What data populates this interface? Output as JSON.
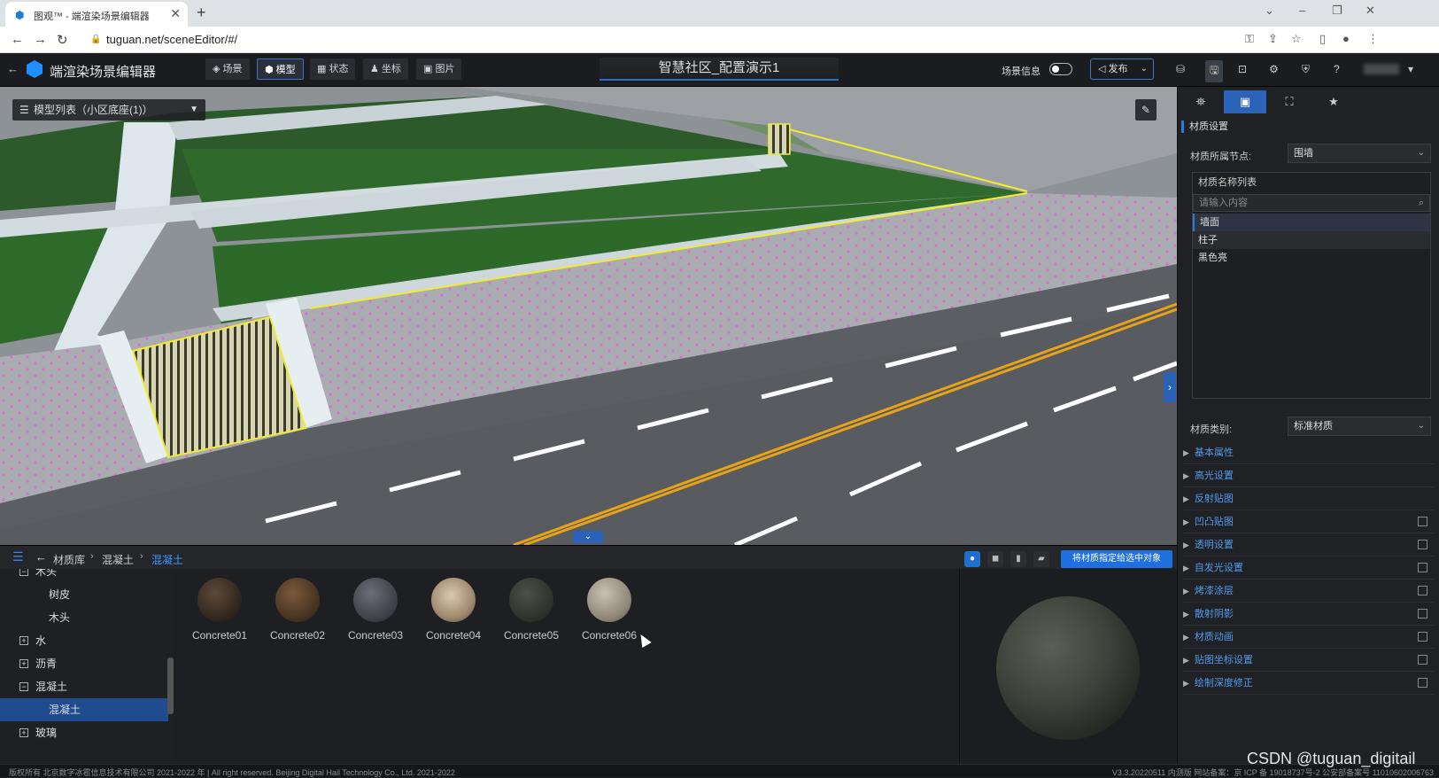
{
  "browser": {
    "tab_title": "图观™ - 端渲染场景编辑器",
    "tab_close": "✕",
    "new_tab": "+",
    "url": "tuguan.net/sceneEditor/#/"
  },
  "app": {
    "title": "端渲染场景编辑器",
    "nav_tabs": [
      {
        "icon": "layers-icon",
        "label": "场景"
      },
      {
        "icon": "cube-icon",
        "label": "模型"
      },
      {
        "icon": "grid-icon",
        "label": "状态"
      },
      {
        "icon": "person-icon",
        "label": "坐标"
      },
      {
        "icon": "image-icon",
        "label": "图片"
      }
    ],
    "active_tab": "模型",
    "scene_name": "智慧社区_配置演示1",
    "scene_info_label": "场景信息",
    "publish_label": "发布",
    "accent_color": "#2b63b9"
  },
  "viewport": {
    "model_list_label": "模型列表（小区底座(1)）"
  },
  "right_panel": {
    "section_title": "材质设置",
    "node_label": "材质所属节点:",
    "node_value": "围墙",
    "material_list_title": "材质名称列表",
    "search_placeholder": "请输入内容",
    "materials": [
      "墙面",
      "柱子",
      "黑色亮"
    ],
    "selected_material": "墙面",
    "type_label": "材质类别:",
    "type_value": "标准材质",
    "properties": [
      {
        "label": "基本属性",
        "checkbox": false
      },
      {
        "label": "高光设置",
        "checkbox": false
      },
      {
        "label": "反射贴图",
        "checkbox": false
      },
      {
        "label": "凹凸贴图",
        "checkbox": true
      },
      {
        "label": "透明设置",
        "checkbox": true
      },
      {
        "label": "自发光设置",
        "checkbox": true
      },
      {
        "label": "烤漆涂层",
        "checkbox": true
      },
      {
        "label": "散射阴影",
        "checkbox": true
      },
      {
        "label": "材质动画",
        "checkbox": true
      },
      {
        "label": "贴图坐标设置",
        "checkbox": true
      },
      {
        "label": "绘制深度修正",
        "checkbox": true
      }
    ]
  },
  "library": {
    "breadcrumb": [
      "材质库",
      "混凝土",
      "混凝土"
    ],
    "tree": [
      {
        "label": "木头",
        "level": 0,
        "toggle": "−"
      },
      {
        "label": "树皮",
        "level": 1
      },
      {
        "label": "木头",
        "level": 1
      },
      {
        "label": "水",
        "level": 0,
        "toggle": "+"
      },
      {
        "label": "沥青",
        "level": 0,
        "toggle": "+"
      },
      {
        "label": "混凝土",
        "level": 0,
        "toggle": "−"
      },
      {
        "label": "混凝土",
        "level": 1,
        "selected": true
      },
      {
        "label": "玻璃",
        "level": 0,
        "toggle": "+"
      }
    ],
    "thumbnails": [
      "Concrete01",
      "Concrete02",
      "Concrete03",
      "Concrete04",
      "Concrete05",
      "Concrete06"
    ],
    "apply_button": "将材质指定给选中对象"
  },
  "footer": {
    "copyright": "版权所有 北京数字冰雹信息技术有限公司 2021-2022 年 | All right reserved. Beijing Digital Hail Technology Co., Ltd. 2021-2022",
    "version": "V3.3.20220511 内测版 网站备案：京 ICP 备 19018737号-2 公安部备案号 11010602006763"
  },
  "watermark": "CSDN @tuguan_digitail"
}
